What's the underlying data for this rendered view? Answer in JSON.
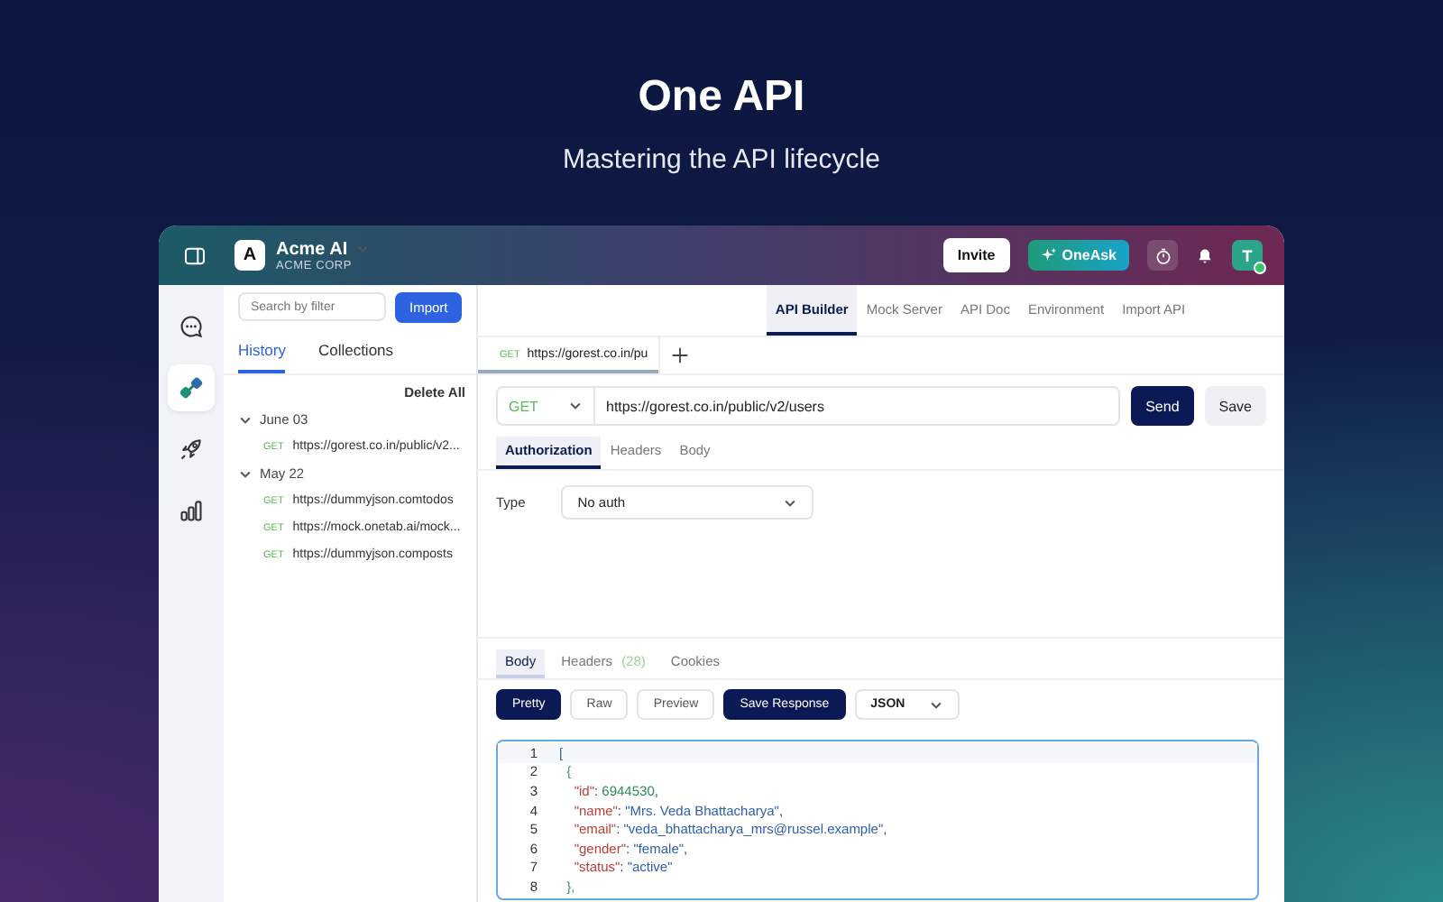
{
  "hero": {
    "title": "One API",
    "subtitle": "Mastering the API lifecycle"
  },
  "workspace": {
    "initial": "A",
    "name": "Acme AI",
    "org": "ACME CORP"
  },
  "header_actions": {
    "invite": "Invite",
    "oneask": "OneAsk",
    "user_initial": "T",
    "online": true
  },
  "rail": [
    {
      "kind": "chat",
      "selected": false
    },
    {
      "kind": "connect",
      "selected": true
    },
    {
      "kind": "rocket",
      "selected": false
    },
    {
      "kind": "chart",
      "selected": false
    }
  ],
  "sidebar": {
    "search": {
      "placeholder": "Search by filter"
    },
    "import": "Import",
    "tabs": [
      {
        "label": "History",
        "selected": true
      },
      {
        "label": "Collections",
        "selected": false
      }
    ],
    "delete_all": "Delete All",
    "groups": [
      {
        "label": "June 03",
        "expanded": true,
        "items": [
          {
            "method": "GET",
            "url": "https://gorest.co.in/public/v2..."
          }
        ]
      },
      {
        "label": "May 22",
        "expanded": true,
        "items": [
          {
            "method": "GET",
            "url": "https://dummyjson.comtodos"
          },
          {
            "method": "GET",
            "url": "https://mock.onetab.ai/mock..."
          },
          {
            "method": "GET",
            "url": "https://dummyjson.composts"
          }
        ]
      }
    ]
  },
  "nav_tabs": [
    {
      "label": "API Builder",
      "selected": true
    },
    {
      "label": "Mock Server",
      "selected": false
    },
    {
      "label": "API Doc",
      "selected": false
    },
    {
      "label": "Environment",
      "selected": false
    },
    {
      "label": "Import API",
      "selected": false
    }
  ],
  "request_tabs": [
    {
      "method": "GET",
      "url": "https://gorest.co.in/pu",
      "selected": true
    }
  ],
  "request": {
    "method": "GET",
    "url": "https://gorest.co.in/public/v2/users",
    "send": "Send",
    "save": "Save",
    "tabs": [
      {
        "label": "Authorization",
        "selected": true
      },
      {
        "label": "Headers",
        "selected": false
      },
      {
        "label": "Body",
        "selected": false
      }
    ],
    "auth_type_label": "Type",
    "auth_type": "No auth"
  },
  "response": {
    "tabs": [
      {
        "label": "Body",
        "selected": true
      },
      {
        "label": "Headers",
        "count": "(28)",
        "selected": false
      },
      {
        "label": "Cookies",
        "selected": false
      }
    ],
    "views": [
      {
        "label": "Pretty",
        "selected": true
      },
      {
        "label": "Raw",
        "selected": false
      },
      {
        "label": "Preview",
        "selected": false
      }
    ],
    "save_response": "Save Response",
    "format": "JSON",
    "lines": [
      {
        "number": "1",
        "tokens": [
          {
            "kind": "bracket",
            "text": "["
          }
        ]
      },
      {
        "number": "2",
        "tokens": [
          {
            "kind": "brace",
            "text": "  {"
          }
        ]
      },
      {
        "number": "3",
        "tokens": [
          {
            "kind": "key",
            "text": "    \"id\""
          },
          {
            "kind": "punct",
            "text": ": "
          },
          {
            "kind": "number",
            "text": "6944530"
          },
          {
            "kind": "punct",
            "text": ","
          }
        ]
      },
      {
        "number": "4",
        "tokens": [
          {
            "kind": "key",
            "text": "    \"name\""
          },
          {
            "kind": "punct",
            "text": ": "
          },
          {
            "kind": "string",
            "text": "\"Mrs. Veda Bhattacharya\""
          },
          {
            "kind": "punct",
            "text": ","
          }
        ]
      },
      {
        "number": "5",
        "tokens": [
          {
            "kind": "key",
            "text": "    \"email\""
          },
          {
            "kind": "punct",
            "text": ": "
          },
          {
            "kind": "string",
            "text": "\"veda_bhattacharya_mrs@russel.example\""
          },
          {
            "kind": "punct",
            "text": ","
          }
        ]
      },
      {
        "number": "6",
        "tokens": [
          {
            "kind": "key",
            "text": "    \"gender\""
          },
          {
            "kind": "punct",
            "text": ": "
          },
          {
            "kind": "string",
            "text": "\"female\""
          },
          {
            "kind": "punct",
            "text": ","
          }
        ]
      },
      {
        "number": "7",
        "tokens": [
          {
            "kind": "key",
            "text": "    \"status\""
          },
          {
            "kind": "punct",
            "text": ": "
          },
          {
            "kind": "string",
            "text": "\"active\""
          }
        ]
      },
      {
        "number": "8",
        "tokens": [
          {
            "kind": "brace",
            "text": "  },"
          }
        ]
      }
    ]
  }
}
